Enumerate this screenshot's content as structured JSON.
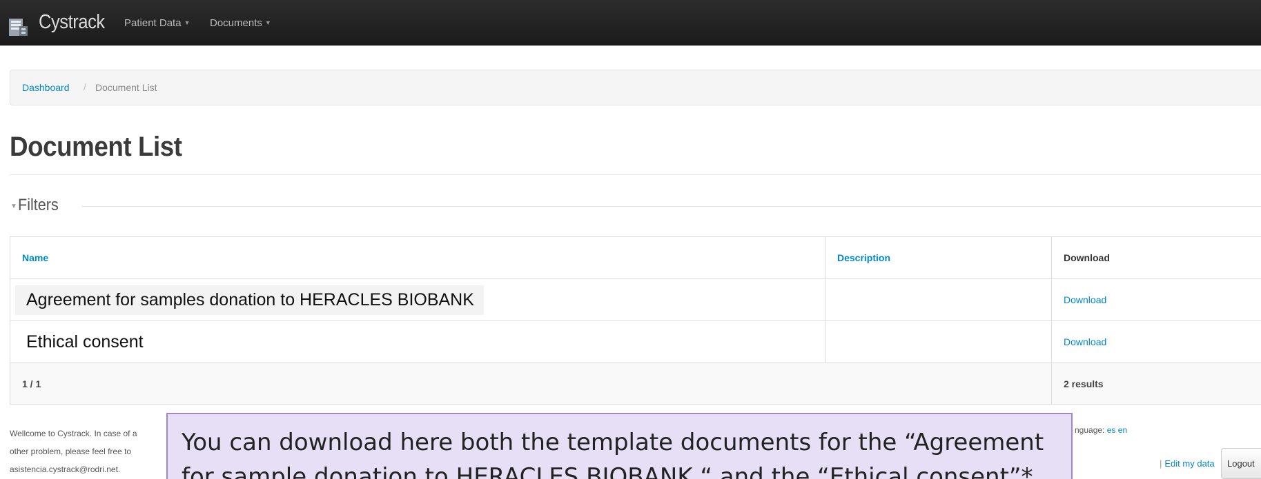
{
  "navbar": {
    "brand": "Cystrack",
    "brand_icon": "building-icon",
    "menu": [
      {
        "label": "Patient Data"
      },
      {
        "label": "Documents"
      }
    ]
  },
  "breadcrumb": {
    "link": "Dashboard",
    "separator": "/",
    "current": "Document List"
  },
  "page": {
    "title": "Document List"
  },
  "filters": {
    "label": "Filters"
  },
  "table": {
    "headers": {
      "name": "Name",
      "description": "Description",
      "download": "Download"
    },
    "rows": [
      {
        "name": "Agreement for samples donation to HERACLES BIOBANK",
        "description": "",
        "download": "Download"
      },
      {
        "name": "Ethical consent",
        "description": "",
        "download": "Download"
      }
    ],
    "footer": {
      "pages": "1 / 1",
      "results": "2 results"
    }
  },
  "footer": {
    "welcome_line1": "Wellcome to Cystrack. In case of a",
    "welcome_line2": "other problem, please feel free to",
    "welcome_line3": "asistencia.cystrack@rodri.net.",
    "language_label": "nguage:",
    "language_es": "es",
    "language_en": "en",
    "edit_my_data": "Edit my data",
    "logout": "Logout"
  },
  "callout": {
    "text": "You can download here both the template documents for the “Agreement for sample donation to HERACLES BIOBANK “ and the “Ethical consent”*"
  },
  "colors": {
    "navbar": "#1b1b1b",
    "link": "#0088cc",
    "callout_bg": "#e6dff5",
    "callout_border": "#9f86cf"
  }
}
